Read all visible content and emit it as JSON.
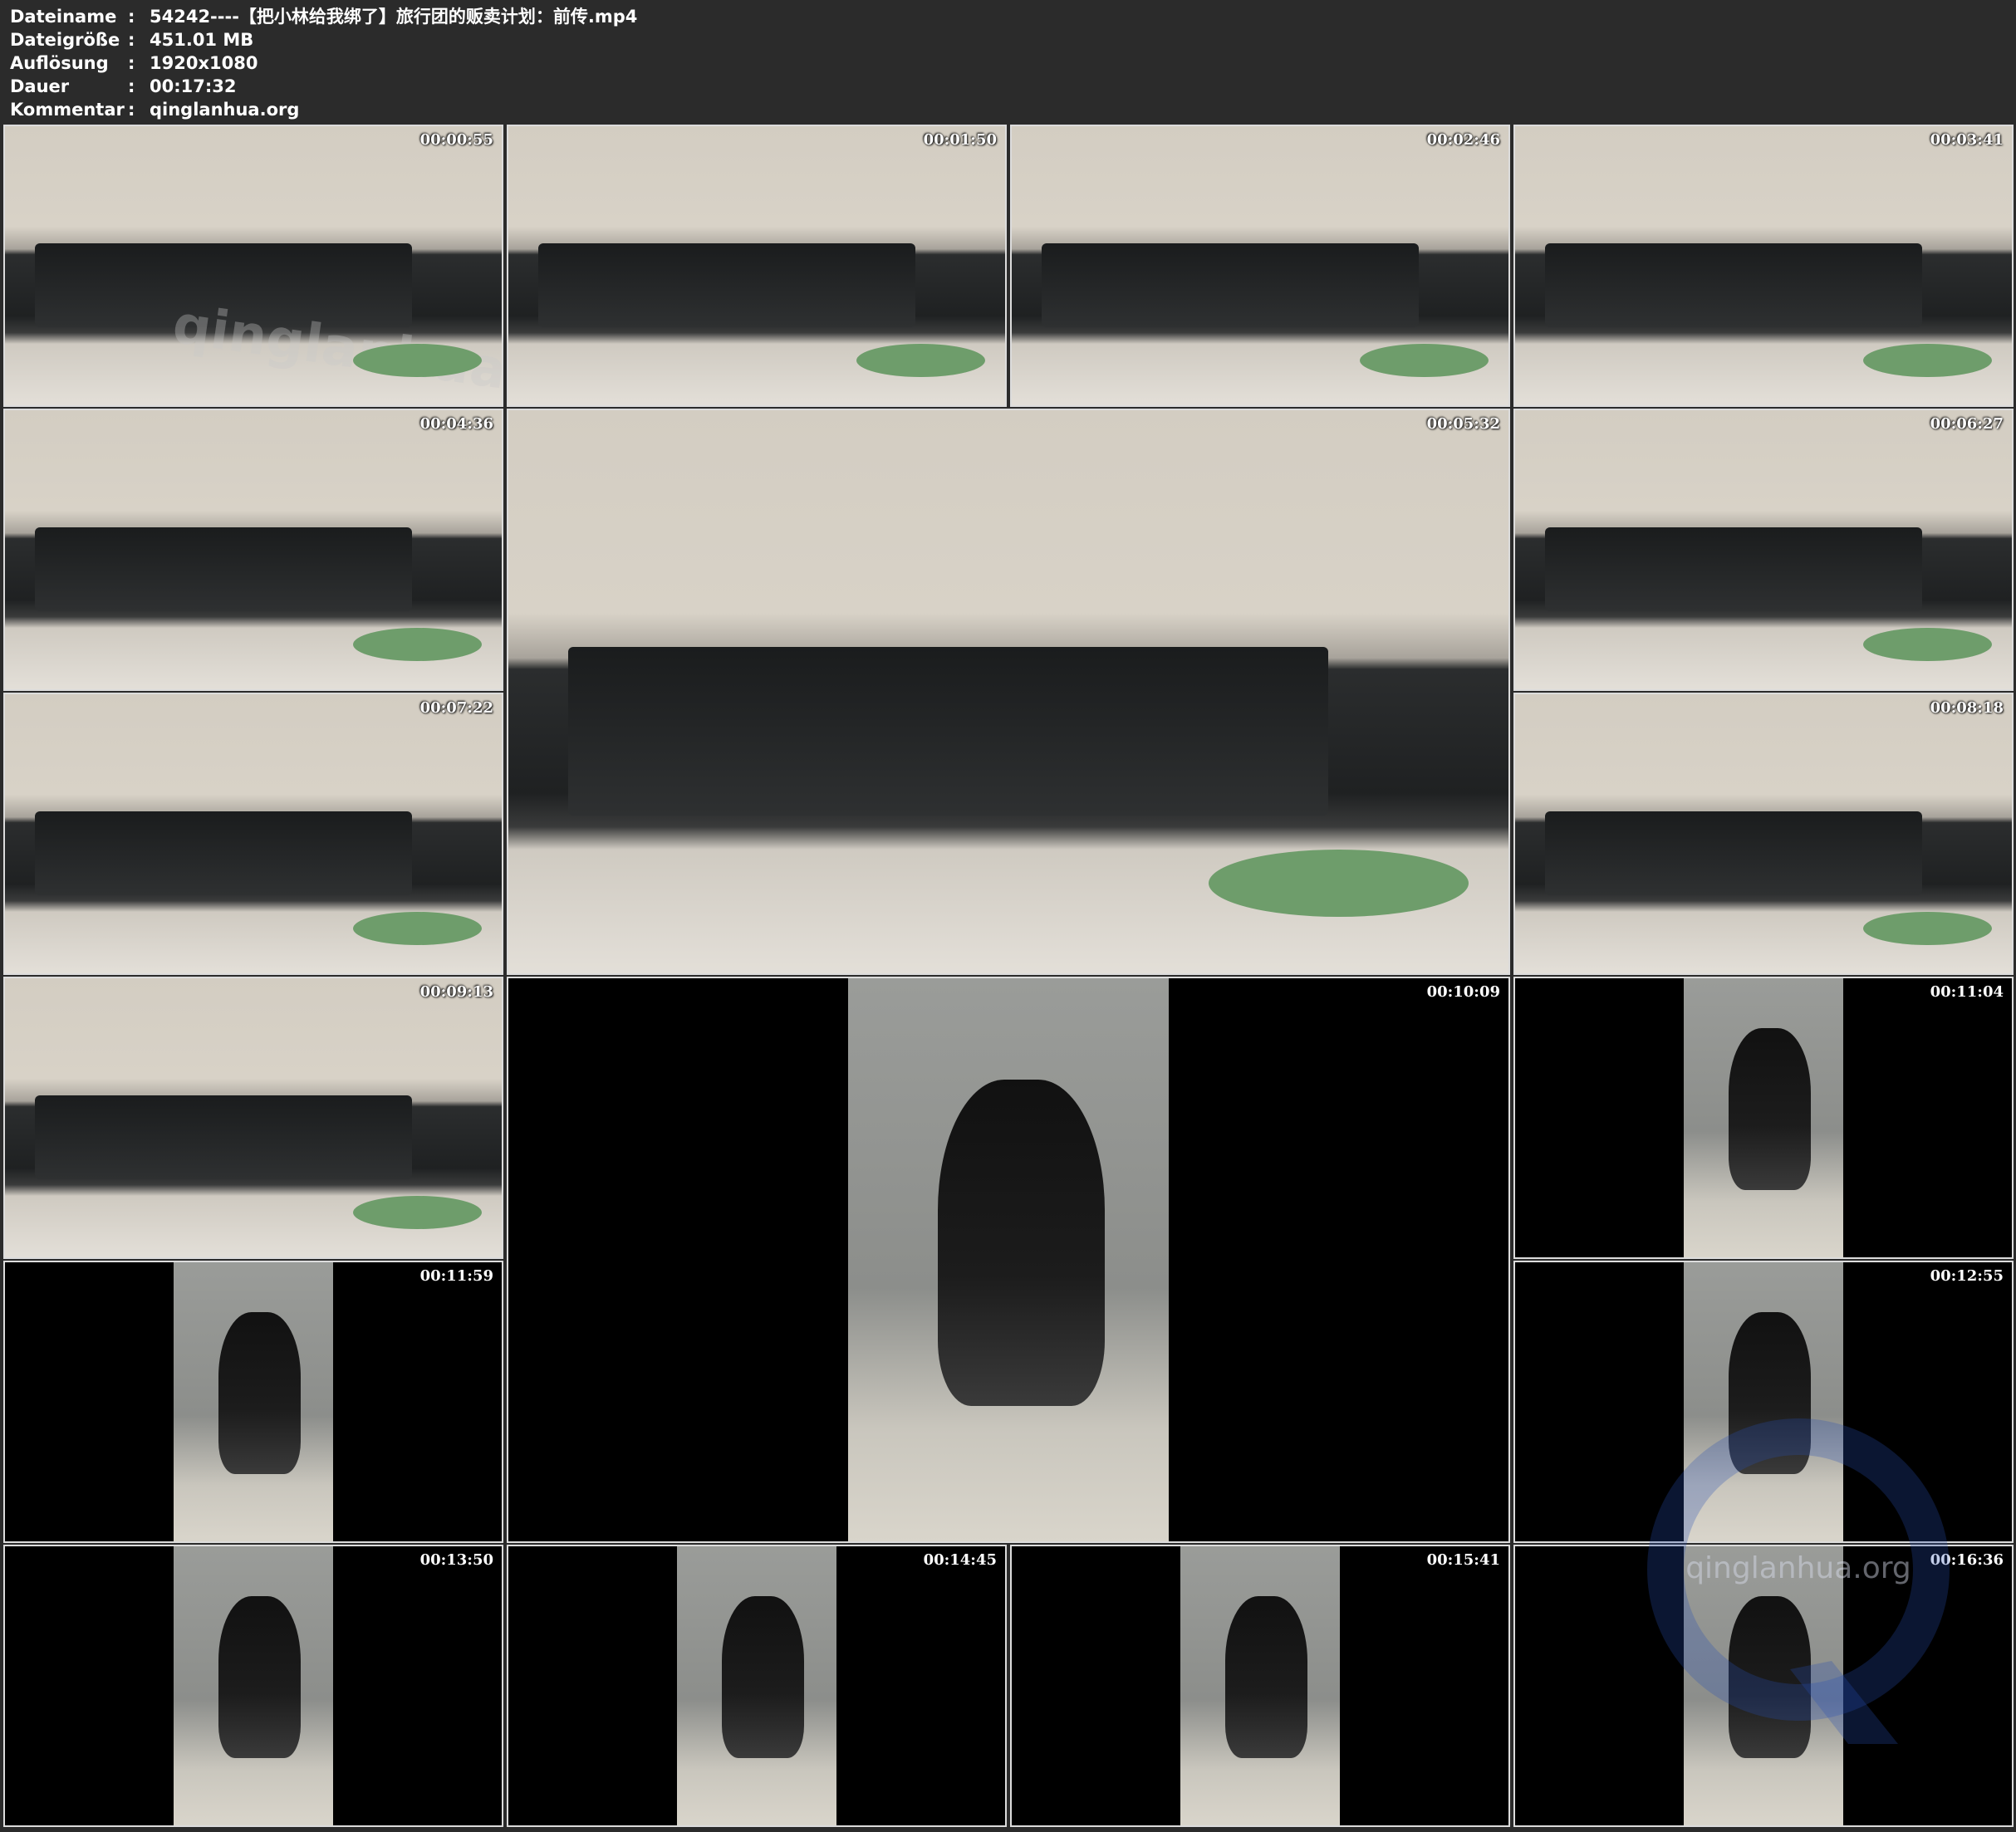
{
  "info": {
    "rows": [
      {
        "key": "Dateiname",
        "sep": ":",
        "value": "54242----【把小林给我绑了】旅行团的贩卖计划：前传.mp4"
      },
      {
        "key": "Dateigröße",
        "sep": ":",
        "value": "451.01 MB"
      },
      {
        "key": "Auflösung",
        "sep": ":",
        "value": "1920x1080"
      },
      {
        "key": "Dauer",
        "sep": ":",
        "value": "00:17:32"
      },
      {
        "key": "Kommentar",
        "sep": ":",
        "value": "qinglanhua.org"
      }
    ]
  },
  "thumbnails": [
    {
      "timestamp": "00:00:55",
      "scene": "room"
    },
    {
      "timestamp": "00:01:50",
      "scene": "room"
    },
    {
      "timestamp": "00:02:46",
      "scene": "room"
    },
    {
      "timestamp": "00:03:41",
      "scene": "room"
    },
    {
      "timestamp": "00:04:36",
      "scene": "room"
    },
    {
      "timestamp": "00:05:32",
      "scene": "room"
    },
    {
      "timestamp": "00:06:27",
      "scene": "room"
    },
    {
      "timestamp": "00:07:22",
      "scene": "room"
    },
    {
      "timestamp": "00:08:18",
      "scene": "room"
    },
    {
      "timestamp": "00:09:13",
      "scene": "room"
    },
    {
      "timestamp": "00:10:09",
      "scene": "shower"
    },
    {
      "timestamp": "00:11:04",
      "scene": "shower"
    },
    {
      "timestamp": "00:11:59",
      "scene": "shower"
    },
    {
      "timestamp": "00:12:55",
      "scene": "shower"
    },
    {
      "timestamp": "00:13:50",
      "scene": "shower"
    },
    {
      "timestamp": "00:14:45",
      "scene": "shower"
    },
    {
      "timestamp": "00:15:41",
      "scene": "shower"
    },
    {
      "timestamp": "00:16:36",
      "scene": "shower"
    }
  ],
  "watermarks": {
    "tile_text": "qinglanhua.net",
    "logo_text": "qinglanhua.org"
  }
}
